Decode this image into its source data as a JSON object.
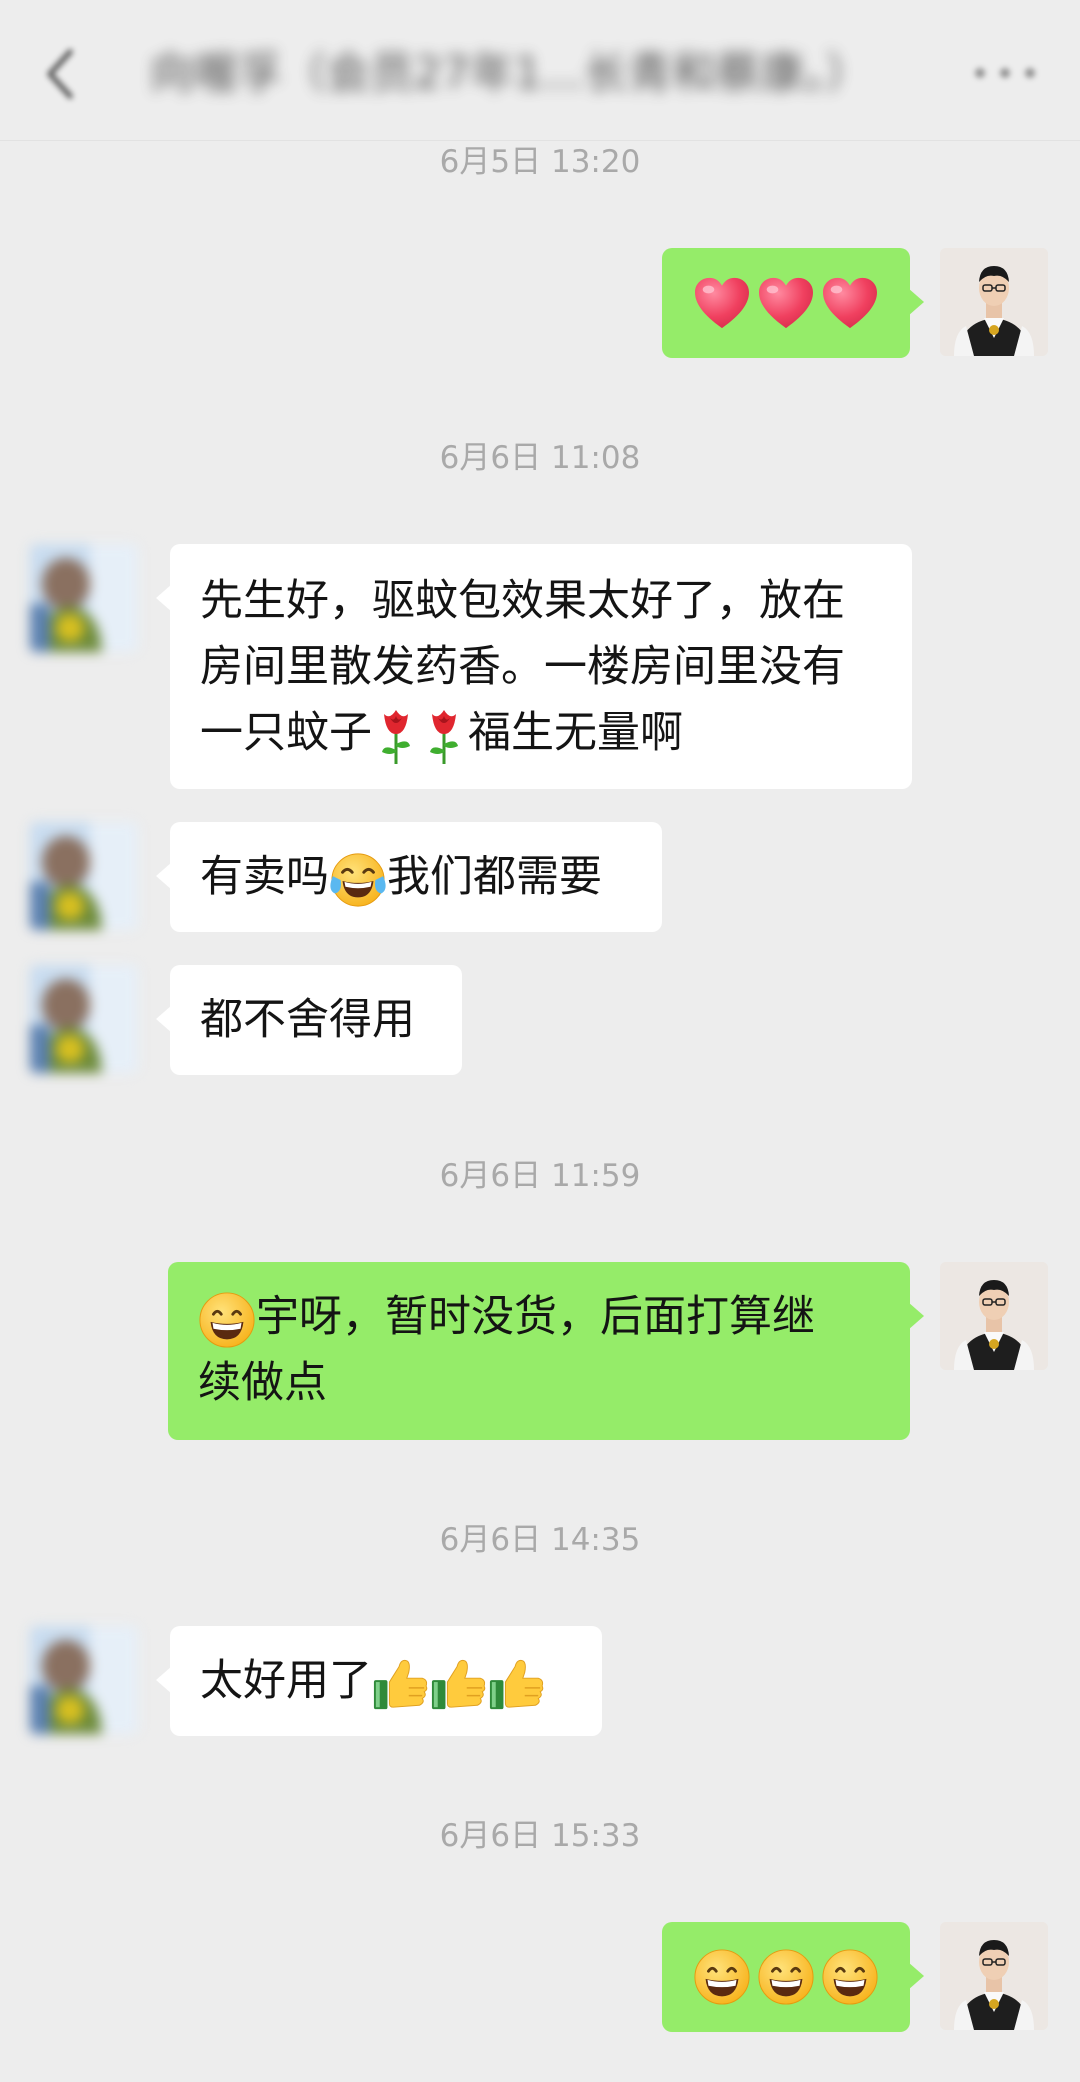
{
  "header": {
    "title": "向喔孚（会员27年1...长青和蔡康。）"
  },
  "messages": {
    "t1": "6月5日 13:20",
    "t2": "6月6日 11:08",
    "m2_line1": "先生好，驱蚊包效果太好了，放在",
    "m2_line2": "房间里散发药香。一楼房间里没有",
    "m2_line3_a": "一只蚊子",
    "m2_line3_b": "福生无量啊",
    "m3_a": "有卖吗",
    "m3_b": "我们都需要",
    "m4": "都不舍得用",
    "t3": "6月6日 11:59",
    "m5_line1": "宇呀，暂时没货，后面打算继",
    "m5_line2": "续做点",
    "t4": "6月6日 14:35",
    "m6": "太好用了",
    "t5": "6月6日 15:33"
  },
  "icons": {
    "heart": "heart-emoji",
    "rose": "rose-emoji",
    "laugh_cry": "face-with-tears-of-joy-emoji",
    "grin": "grinning-face-emoji",
    "thumbs_up": "thumbs-up-emoji"
  },
  "colors": {
    "background": "#ededed",
    "outgoing_bubble": "#95ec69",
    "incoming_bubble": "#ffffff",
    "timestamp": "#a9a9a9"
  }
}
